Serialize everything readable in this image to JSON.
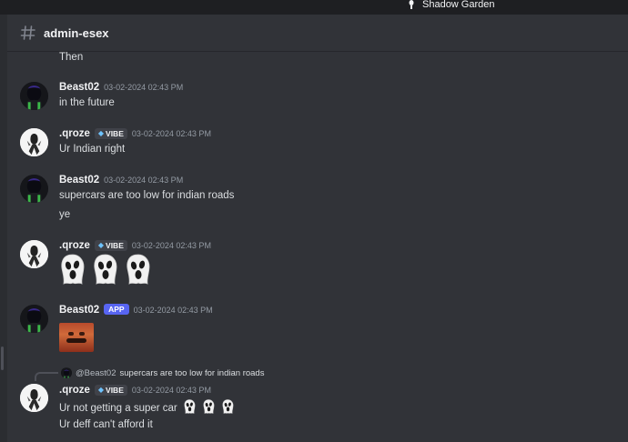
{
  "server": {
    "name": "Shadow Garden",
    "icon": "server-icon"
  },
  "channel": {
    "name": "admin-esex",
    "icon": "hash-icon"
  },
  "colors": {
    "background": "#313338",
    "app_badge": "#5865f2",
    "vibe_gem": "#6ec3ff",
    "text": "#dbdee1"
  },
  "messages": [
    {
      "text": "Then"
    },
    {
      "username": "Beast02",
      "timestamp": "03-02-2024 02:43 PM",
      "lines": [
        "in the future"
      ]
    },
    {
      "username": ".qroze",
      "badge": "VIBE",
      "timestamp": "03-02-2024 02:43 PM",
      "lines": [
        "Ur Indian right"
      ]
    },
    {
      "username": "Beast02",
      "timestamp": "03-02-2024 02:43 PM",
      "lines": [
        "supercars are too low for indian roads",
        "ye"
      ]
    },
    {
      "username": ".qroze",
      "badge": "VIBE",
      "timestamp": "03-02-2024 02:43 PM",
      "emojis": [
        "ghost-emoji",
        "ghost-emoji",
        "ghost-emoji"
      ]
    },
    {
      "username": "Beast02",
      "badge": "APP",
      "timestamp": "03-02-2024 02:43 PM",
      "attachment": "reaction-image"
    },
    {
      "reply_to": {
        "username": "@Beast02",
        "text": "supercars are too low for indian roads"
      },
      "username": ".qroze",
      "badge": "VIBE",
      "timestamp": "03-02-2024 02:43 PM",
      "lines": [
        "Ur not getting a super car",
        "Ur deff can't afford it"
      ]
    }
  ]
}
